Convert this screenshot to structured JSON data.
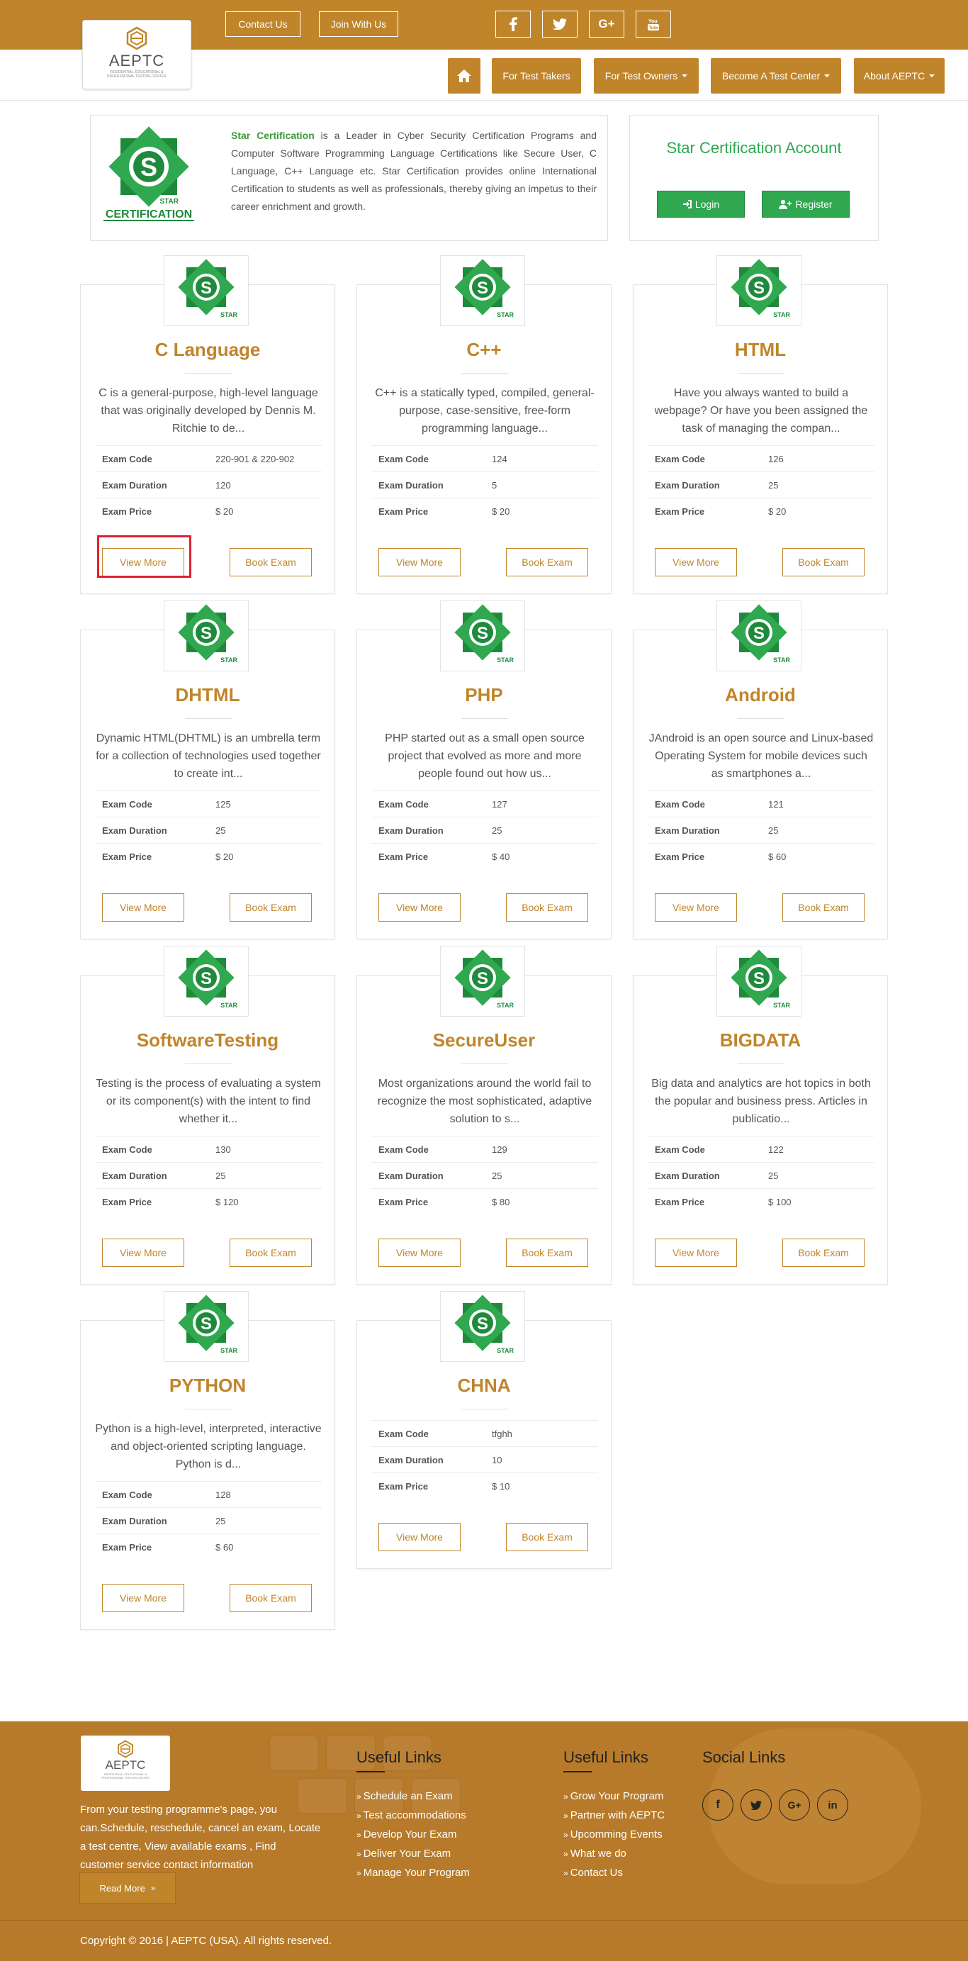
{
  "header": {
    "brand": "AEPTC",
    "brand_sub": "RESIDENTIAL, EDUCATIONAL & PROFESSIONAL TESTING CENTER",
    "contact_label": "Contact Us",
    "join_label": "Join With Us",
    "social_icons": [
      "facebook-icon",
      "twitter-icon",
      "google-plus-icon",
      "youtube-icon"
    ]
  },
  "nav": {
    "home_icon": "home-icon",
    "items": [
      {
        "label": "For Test Takers",
        "dropdown": false
      },
      {
        "label": "For Test Owners",
        "dropdown": true
      },
      {
        "label": "Become A Test Center",
        "dropdown": true
      },
      {
        "label": "About AEPTC",
        "dropdown": true
      }
    ]
  },
  "intro": {
    "logo_text": "CERTIFICATION",
    "logo_star": "STAR",
    "brand": "Star Certification",
    "text": " is a Leader in Cyber Security Certification Programs and Computer Software Programming Language Certifications like Secure User, C Language, C++ Language etc. Star Certification provides online International Certification to students as well as professionals, thereby giving an impetus to their career enrichment and growth."
  },
  "account": {
    "title": "Star Certification Account",
    "login_label": "Login",
    "register_label": "Register"
  },
  "labels": {
    "exam_code": "Exam Code",
    "exam_duration": "Exam Duration",
    "exam_price": "Exam Price",
    "view_more": "View More",
    "book_exam": "Book Exam",
    "star": "STAR"
  },
  "courses": [
    {
      "title": "C Language",
      "desc": "C is a general-purpose, high-level language that was originally developed by Dennis M. Ritchie to de...",
      "code": "220-901 & 220-902",
      "duration": "120",
      "price": "$ 20"
    },
    {
      "title": "C++",
      "desc": "C++ is a statically typed, compiled, general-purpose, case-sensitive, free-form programming language...",
      "code": "124",
      "duration": "5",
      "price": "$ 20"
    },
    {
      "title": "HTML",
      "desc": "Have you always wanted to build a webpage? Or have you been assigned the task of managing the compan...",
      "code": "126",
      "duration": "25",
      "price": "$ 20"
    },
    {
      "title": "DHTML",
      "desc": "Dynamic HTML(DHTML) is an umbrella term for a collection of technologies used together to create int...",
      "code": "125",
      "duration": "25",
      "price": "$ 20"
    },
    {
      "title": "PHP",
      "desc": "PHP started out as a small open source project that evolved as more and more people found out how us...",
      "code": "127",
      "duration": "25",
      "price": "$ 40"
    },
    {
      "title": "Android",
      "desc": "JAndroid is an open source and Linux-based Operating System for mobile devices such as smartphones a...",
      "code": "121",
      "duration": "25",
      "price": "$ 60"
    },
    {
      "title": "SoftwareTesting",
      "desc": "Testing is the process of evaluating a system or its component(s) with the intent to find whether it...",
      "code": "130",
      "duration": "25",
      "price": "$ 120"
    },
    {
      "title": "SecureUser",
      "desc": "Most organizations around the world fail to recognize the most sophisticated, adaptive solution to s...",
      "code": "129",
      "duration": "25",
      "price": "$ 80"
    },
    {
      "title": "BIGDATA",
      "desc": "Big data and analytics are hot topics in both the popular and business press. Articles in publicatio...",
      "code": "122",
      "duration": "25",
      "price": "$ 100"
    },
    {
      "title": "PYTHON",
      "desc": "Python is a high-level, interpreted, interactive and object-oriented scripting language. Python is d...",
      "code": "128",
      "duration": "25",
      "price": "$ 60"
    },
    {
      "title": "CHNA",
      "desc": "",
      "code": "tfghh",
      "duration": "10",
      "price": "$ 10"
    }
  ],
  "footer": {
    "about": "From your testing programme's page, you can.Schedule, reschedule, cancel an exam, Locate a test centre, View available exams , Find customer service contact information",
    "read_more": "Read More",
    "useful_links_1_title": "Useful Links",
    "useful_links_1": [
      "Schedule an Exam",
      "Test accommodations",
      "Develop Your Exam",
      "Deliver Your Exam",
      "Manage Your Program"
    ],
    "useful_links_2_title": "Useful Links",
    "useful_links_2": [
      "Grow Your Program",
      "Partner with AEPTC",
      "Upcomming Events",
      "What we do",
      "Contact Us"
    ],
    "social_title": "Social Links",
    "social_icons": [
      "facebook-icon",
      "twitter-icon",
      "google-plus-icon",
      "linkedin-icon"
    ],
    "copyright": "Copyright © 2016 | AEPTC (USA). All rights reserved."
  },
  "colors": {
    "brand": "#c0852a",
    "green": "#2fa84f",
    "highlight": "#e0212f"
  }
}
